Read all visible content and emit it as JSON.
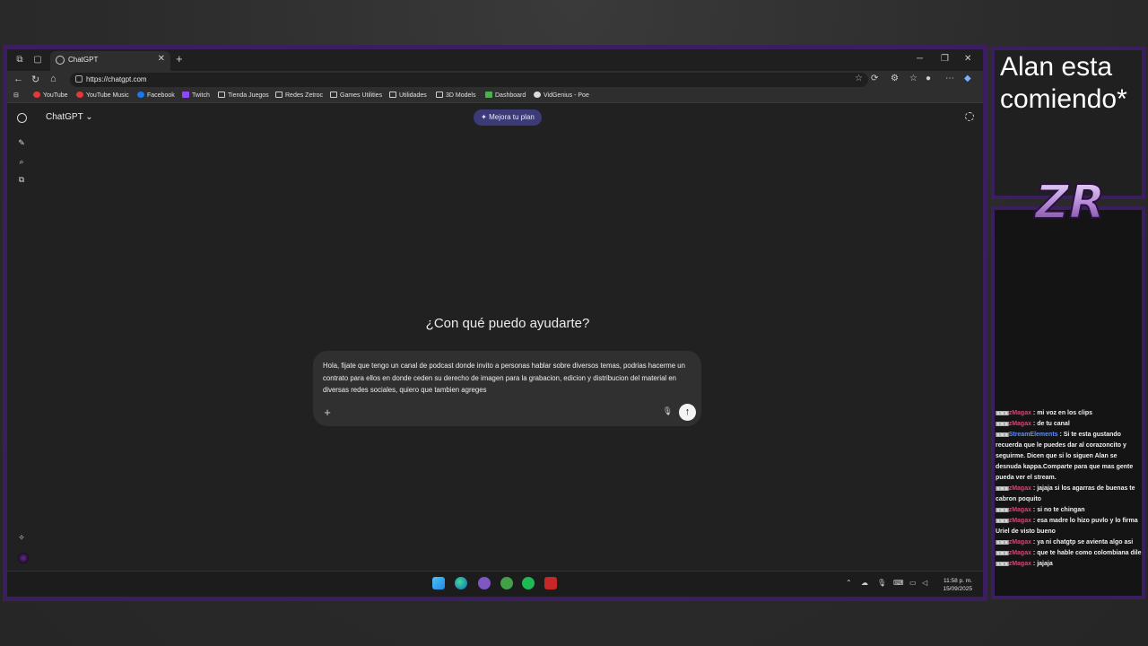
{
  "browser": {
    "tab_title": "ChatGPT",
    "url": "https://chatgpt.com",
    "bookmarks": [
      {
        "label": "YouTube",
        "icon": "youtube-icon"
      },
      {
        "label": "YouTube Music",
        "icon": "youtube-music-icon"
      },
      {
        "label": "Facebook",
        "icon": "facebook-icon"
      },
      {
        "label": "Twitch",
        "icon": "twitch-icon"
      },
      {
        "label": "Tienda Juegos",
        "icon": "folder-icon"
      },
      {
        "label": "Redes Zetroc",
        "icon": "folder-icon"
      },
      {
        "label": "Games Utilities",
        "icon": "folder-icon"
      },
      {
        "label": "Utilidades",
        "icon": "folder-icon"
      },
      {
        "label": "3D Models",
        "icon": "folder-icon"
      },
      {
        "label": "Dashboard",
        "icon": "dashboard-icon"
      },
      {
        "label": "VidGenius - Poe",
        "icon": "poe-icon"
      }
    ]
  },
  "chatgpt": {
    "model": "ChatGPT",
    "upgrade_label": "Mejora tu plan",
    "heading": "¿Con qué puedo ayudarte?",
    "prompt_text": "Hola, fijate que tengo un canal de podcast donde invito a personas hablar sobre diversos temas, podrias hacerme un contrato para ellos en donde ceden su derecho de imagen para la grabacion, edicion y distribucion del material en diversas redes sociales, quiero que tambien agreges"
  },
  "taskbar": {
    "time": "11:58 p. m.",
    "date": "15/09/2025"
  },
  "overlay": {
    "title": "Alan esta comiendo*",
    "logo_text": "ZR"
  },
  "chat": {
    "messages": [
      {
        "user": "zMagax",
        "color": "#e0407a",
        "text": "mi voz en los clips"
      },
      {
        "user": "zMagax",
        "color": "#e0407a",
        "text": "de tu canal"
      },
      {
        "user": "StreamElements",
        "color": "#5b8cff",
        "text": "Si te esta gustando recuerda que le puedes dar al corazoncito y seguirme. Dicen que si lo siguen Alan se desnuda kappa.Comparte para que mas gente pueda ver el stream."
      },
      {
        "user": "zMagax",
        "color": "#e0407a",
        "text": "jajaja si los agarras de buenas te cabron poquito"
      },
      {
        "user": "zMagax",
        "color": "#e0407a",
        "text": "si no te chingan"
      },
      {
        "user": "zMagax",
        "color": "#e0407a",
        "text": "esa madre lo hizo puvlo y lo firma Uriel de visto bueno"
      },
      {
        "user": "zMagax",
        "color": "#e0407a",
        "text": "ya ni chatgtp se avienta algo asi"
      },
      {
        "user": "zMagax",
        "color": "#e0407a",
        "text": "que te hable como colombiana dile"
      },
      {
        "user": "zMagax",
        "color": "#e0407a",
        "text": "jajaja"
      }
    ]
  }
}
